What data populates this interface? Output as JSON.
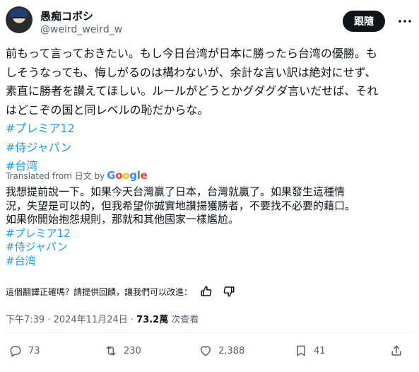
{
  "author": {
    "name": "愚痴コボシ",
    "handle": "@weird_weird_w",
    "follow_label": "跟隨"
  },
  "tweet": {
    "original_lines": [
      "前もって言っておきたい。もし今日台湾が日本に勝ったら台湾の優勝。も",
      "しそうなっても、悔しがるのは構わないが、余計な言い訳は絶対にせず、",
      "素直に勝者を讃えてほしい。ルールがどうとかグダグダ言いだせば、それ",
      "はどこぞの国と同レベルの恥だからな。"
    ],
    "hashtags": [
      "#プレミア12",
      "#侍ジャパン",
      "#台湾"
    ],
    "translated_from": "Translated from 日文 by",
    "translator": "Google",
    "translated_lines": [
      "我想提前說一下。如果今天台灣贏了日本，台灣就贏了。如果發生這種情",
      "況，失望是可以的，但我希望你誠實地讚揚獲勝者，不要找不必要的藉口。",
      "如果你開始抱怨規則，那就和其他國家一樣尷尬。"
    ],
    "feedback_prompt": "這個翻譯正確嗎？請提供回饋，讓我們可以改進："
  },
  "meta": {
    "timestamp": "下午7:39 · 2024年11月24日 · ",
    "views_count": "73.2萬",
    "views_label": " 次查看"
  },
  "actions": {
    "replies": "73",
    "reposts": "230",
    "likes": "2,388",
    "bookmarks": "41"
  },
  "colors": {
    "hashtag": "#1d9bf0",
    "muted": "#536471",
    "text": "#0f1419"
  }
}
